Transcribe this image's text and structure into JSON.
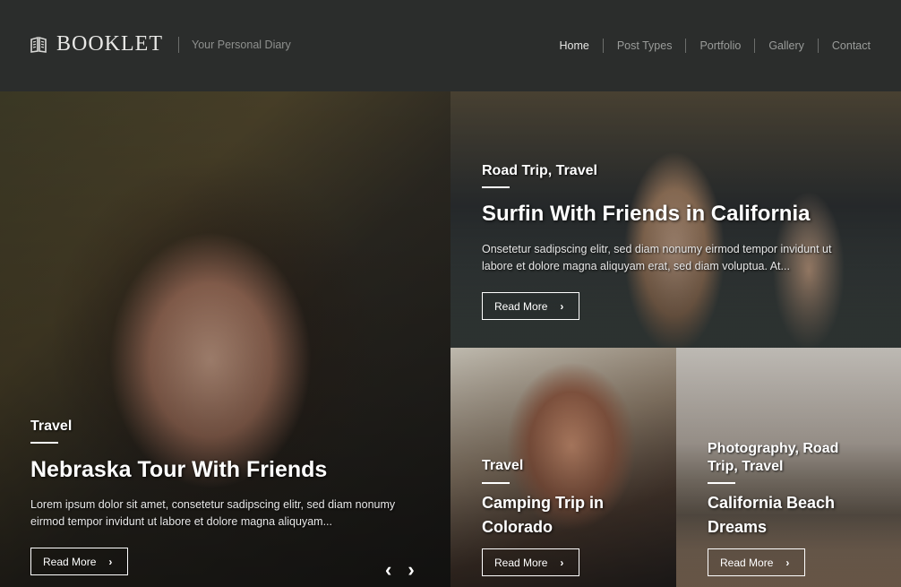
{
  "header": {
    "logo_text": "BOOKLET",
    "tagline": "Your Personal Diary",
    "logo_icon": "book-icon",
    "nav": [
      "Home",
      "Post Types",
      "Portfolio",
      "Gallery",
      "Contact"
    ]
  },
  "posts": [
    {
      "category": "Travel",
      "title": "Nebraska Tour With Friends",
      "excerpt": "Lorem ipsum dolor sit amet, consetetur sadipscing elitr, sed diam nonumy eirmod tempor invidunt ut labore et dolore magna aliquyam...",
      "button": "Read More"
    },
    {
      "category": "Road Trip, Travel",
      "title": "Surfin With Friends in California",
      "excerpt": "Onsetetur sadipscing elitr, sed diam nonumy eirmod tempor invidunt ut labore et dolore magna aliquyam erat, sed diam voluptua. At...",
      "button": "Read More"
    },
    {
      "category": "Travel",
      "title": "Camping Trip in Colorado",
      "button": "Read More"
    },
    {
      "category": "Photography, Road Trip, Travel",
      "title": "California Beach Dreams",
      "button": "Read More"
    }
  ],
  "slider": {
    "prev_icon": "chevron-left-icon",
    "next_icon": "chevron-right-icon"
  }
}
